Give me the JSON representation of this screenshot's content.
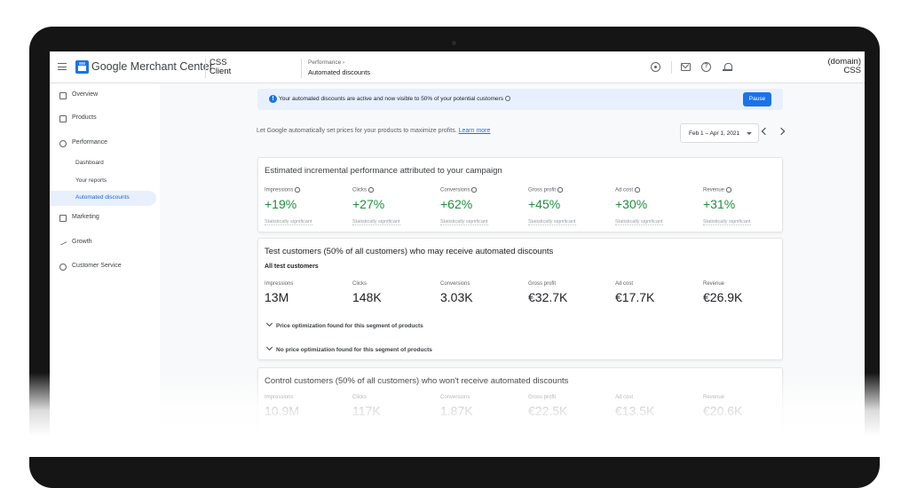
{
  "header": {
    "brand": "Google Merchant Center",
    "client": "CSS Client",
    "breadcrumb_parent": "Performance",
    "breadcrumb_current": "Automated discounts",
    "account_line1": "(domain)",
    "account_line2": "CSS",
    "icons": [
      "menu-icon",
      "settings-icon",
      "mail-icon",
      "help-icon",
      "notifications-icon"
    ]
  },
  "sidebar": {
    "items": [
      {
        "label": "Overview",
        "icon": "overview-icon"
      },
      {
        "label": "Products",
        "icon": "products-icon"
      },
      {
        "label": "Performance",
        "icon": "performance-icon"
      },
      {
        "label": "Dashboard"
      },
      {
        "label": "Your reports"
      },
      {
        "label": "Automated discounts",
        "active": true
      },
      {
        "label": "Marketing",
        "icon": "marketing-icon"
      },
      {
        "label": "Growth",
        "icon": "growth-icon"
      },
      {
        "label": "Customer Service",
        "icon": "customer-service-icon"
      }
    ]
  },
  "banner": {
    "text": "Your automated discounts are active and now visible to 50% of your potential customers",
    "button": "Pause"
  },
  "intro": {
    "text": "Let Google automatically set prices for your products to maximize profits.",
    "link": "Learn more"
  },
  "date_range": "Feb 1 – Apr 1, 2021",
  "incremental": {
    "title": "Estimated incremental performance attributed to your campaign",
    "metrics": [
      {
        "label": "Impressions",
        "value": "+19%",
        "note": "Statistically significant"
      },
      {
        "label": "Clicks",
        "value": "+27%",
        "note": "Statistically significant"
      },
      {
        "label": "Conversions",
        "value": "+62%",
        "note": "Statistically significant"
      },
      {
        "label": "Gross profit",
        "value": "+45%",
        "note": "Statistically significant"
      },
      {
        "label": "Ad cost",
        "value": "+30%",
        "note": "Statistically significant"
      },
      {
        "label": "Revenue",
        "value": "+31%",
        "note": "Statistically significant"
      }
    ]
  },
  "test": {
    "title": "Test customers (50% of all customers) who may receive automated discounts",
    "subtitle": "All test customers",
    "metrics": [
      {
        "label": "Impressions",
        "value": "13M"
      },
      {
        "label": "Clicks",
        "value": "148K"
      },
      {
        "label": "Conversions",
        "value": "3.03K"
      },
      {
        "label": "Gross profit",
        "value": "€32.7K"
      },
      {
        "label": "Ad cost",
        "value": "€17.7K"
      },
      {
        "label": "Revenue",
        "value": "€26.9K"
      }
    ],
    "segments": [
      "Price optimization found for this segment of products",
      "No price optimization found for this segment of products"
    ]
  },
  "control": {
    "title": "Control customers (50% of all customers) who won't receive automated discounts",
    "metrics": [
      {
        "label": "Impressions",
        "value": "10.9M"
      },
      {
        "label": "Clicks",
        "value": "117K"
      },
      {
        "label": "Conversions",
        "value": "1.87K"
      },
      {
        "label": "Gross profit",
        "value": "€22.5K"
      },
      {
        "label": "Ad cost",
        "value": "€13.5K"
      },
      {
        "label": "Revenue",
        "value": "€20.6K"
      }
    ]
  },
  "colors": {
    "accent": "#1a73e8",
    "positive": "#1e8e3e",
    "banner_bg": "#e8f0fe"
  }
}
